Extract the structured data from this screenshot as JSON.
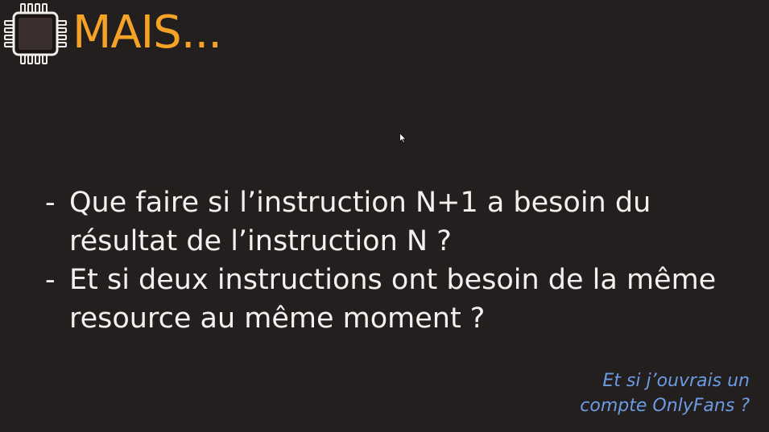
{
  "slide": {
    "title": "MAIS...",
    "bullets": [
      {
        "dash": "-",
        "line1": "Que faire si l’instruction N+1 a besoin du",
        "line2": "résultat de l’instruction N ?"
      },
      {
        "dash": "-",
        "line1": "Et si deux instructions ont besoin de la même",
        "line2": "resource au même moment ?"
      }
    ],
    "note": {
      "line1": "Et si j’ouvrais un",
      "line2": "compte OnlyFans ?"
    }
  },
  "colors": {
    "background": "#231f1e",
    "title": "#f4a326",
    "body_text": "#f3f1ef",
    "note_text": "#6c9be4",
    "chip_body": "#3a2f2c",
    "chip_outline": "#f0eeec"
  },
  "icons": {
    "logo": "cpu-chip-icon",
    "pointer": "mouse-cursor-icon"
  }
}
